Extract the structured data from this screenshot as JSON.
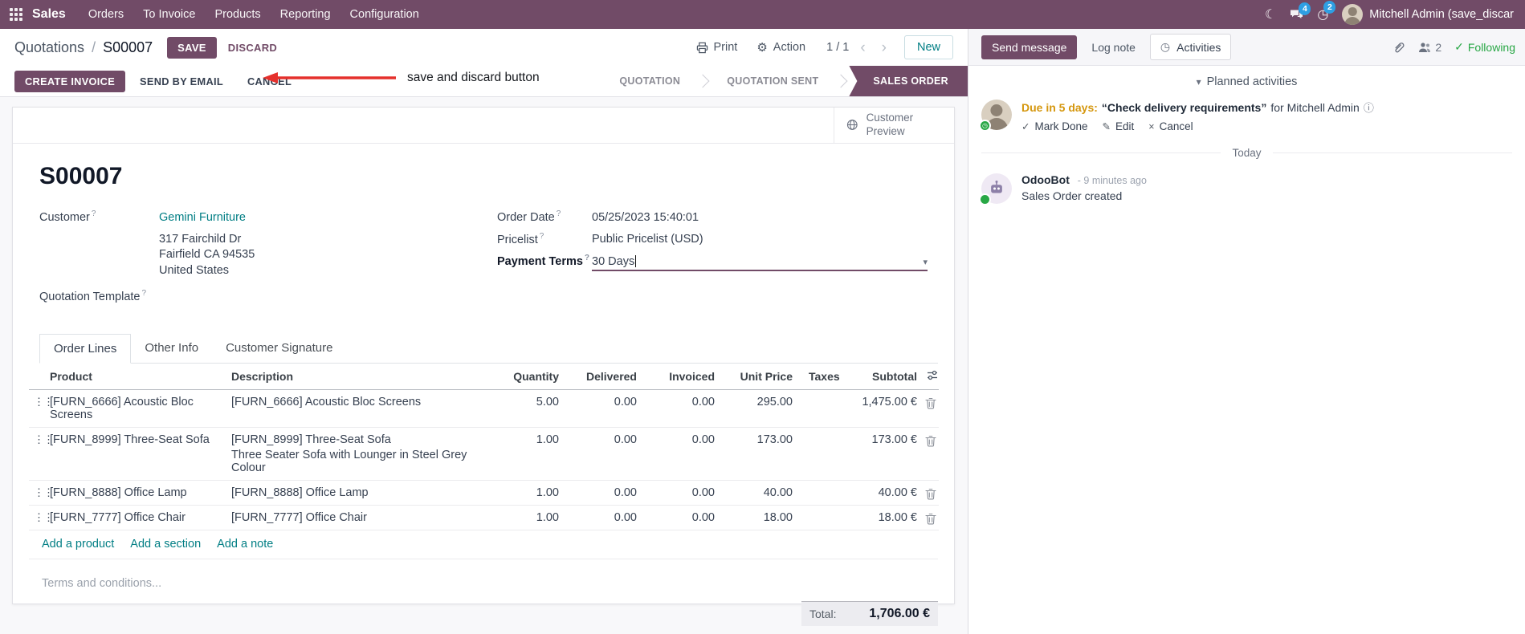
{
  "colors": {
    "accent": "#714B67",
    "link": "#017e84",
    "blue": "#2d6cda",
    "warn": "#d5970e",
    "green": "#28a745",
    "red": "#e5302c",
    "badge": "#2e9fe3"
  },
  "icons": {
    "moon": "☾",
    "clock": "◷",
    "gear": "⚙",
    "chevron_left": "‹",
    "chevron_right": "›",
    "caret_down": "▾",
    "check": "✓",
    "pencil": "✎",
    "cross": "×",
    "info": "ⓘ",
    "drag": "⋮⋮",
    "help": "?",
    "slash": "/"
  },
  "navbar": {
    "app_name": "Sales",
    "menus": [
      "Orders",
      "To Invoice",
      "Products",
      "Reporting",
      "Configuration"
    ],
    "badges": {
      "chat": "4",
      "clock": "2"
    },
    "user": "Mitchell Admin (save_discar"
  },
  "breadcrumb": {
    "path": "Quotations",
    "current": "S00007",
    "save": "SAVE",
    "discard": "DISCARD"
  },
  "annotation": {
    "text": "save and discard button"
  },
  "control_panel": {
    "print": "Print",
    "action": "Action",
    "pager": "1 / 1",
    "new": "New"
  },
  "statusbar": {
    "buttons": [
      "CREATE INVOICE",
      "SEND BY EMAIL",
      "CANCEL"
    ],
    "stages": [
      {
        "label": "QUOTATION",
        "active": false
      },
      {
        "label": "QUOTATION SENT",
        "active": false
      },
      {
        "label": "SALES ORDER",
        "active": true
      }
    ]
  },
  "sheet": {
    "preview_button": "Customer Preview",
    "title": "S00007",
    "fields": {
      "customer_label": "Customer",
      "customer_value": "Gemini Furniture",
      "address": [
        "317 Fairchild Dr",
        "Fairfield CA 94535",
        "United States"
      ],
      "quotation_template_label": "Quotation Template",
      "order_date_label": "Order Date",
      "order_date": "05/25/2023 15:40:01",
      "pricelist_label": "Pricelist",
      "pricelist": "Public Pricelist (USD)",
      "payment_terms_label": "Payment Terms",
      "payment_terms": "30 Days"
    },
    "tabs": [
      {
        "label": "Order Lines",
        "active": true
      },
      {
        "label": "Other Info",
        "active": false
      },
      {
        "label": "Customer Signature",
        "active": false
      }
    ],
    "order_lines": {
      "columns": [
        "Product",
        "Description",
        "Quantity",
        "Delivered",
        "Invoiced",
        "Unit Price",
        "Taxes",
        "Subtotal"
      ],
      "rows": [
        {
          "product": "[FURN_6666] Acoustic Bloc Screens",
          "description": "[FURN_6666] Acoustic Bloc Screens",
          "description2": "",
          "quantity": "5.00",
          "delivered": "0.00",
          "invoiced": "0.00",
          "unit_price": "295.00",
          "taxes": "",
          "subtotal": "1,475.00 €",
          "highlight": false
        },
        {
          "product": "[FURN_8999] Three-Seat Sofa",
          "description": "[FURN_8999] Three-Seat Sofa",
          "description2": "Three Seater Sofa with Lounger in Steel Grey Colour",
          "quantity": "1.00",
          "delivered": "0.00",
          "invoiced": "0.00",
          "unit_price": "173.00",
          "taxes": "",
          "subtotal": "173.00 €",
          "highlight": true
        },
        {
          "product": "[FURN_8888] Office Lamp",
          "description": "[FURN_8888] Office Lamp",
          "description2": "",
          "quantity": "1.00",
          "delivered": "0.00",
          "invoiced": "0.00",
          "unit_price": "40.00",
          "taxes": "",
          "subtotal": "40.00 €",
          "highlight": false
        },
        {
          "product": "[FURN_7777] Office Chair",
          "description": "[FURN_7777] Office Chair",
          "description2": "",
          "quantity": "1.00",
          "delivered": "0.00",
          "invoiced": "0.00",
          "unit_price": "18.00",
          "taxes": "",
          "subtotal": "18.00 €",
          "highlight": false
        }
      ],
      "links": [
        "Add a product",
        "Add a section",
        "Add a note"
      ]
    },
    "terms_placeholder": "Terms and conditions...",
    "total_label": "Total:",
    "total_value": "1,706.00 €"
  },
  "chatter": {
    "send_message": "Send message",
    "log_note": "Log note",
    "activities": "Activities",
    "followers_count": "2",
    "following": "Following",
    "planned_header": "Planned activities",
    "activity": {
      "due": "Due in 5 days:",
      "summary": "“Check delivery requirements”",
      "for_text": "for Mitchell Admin",
      "mark_done": "Mark Done",
      "edit": "Edit",
      "cancel": "Cancel"
    },
    "today": "Today",
    "message": {
      "author": "OdooBot",
      "time": "- 9 minutes ago",
      "body": "Sales Order created"
    }
  }
}
